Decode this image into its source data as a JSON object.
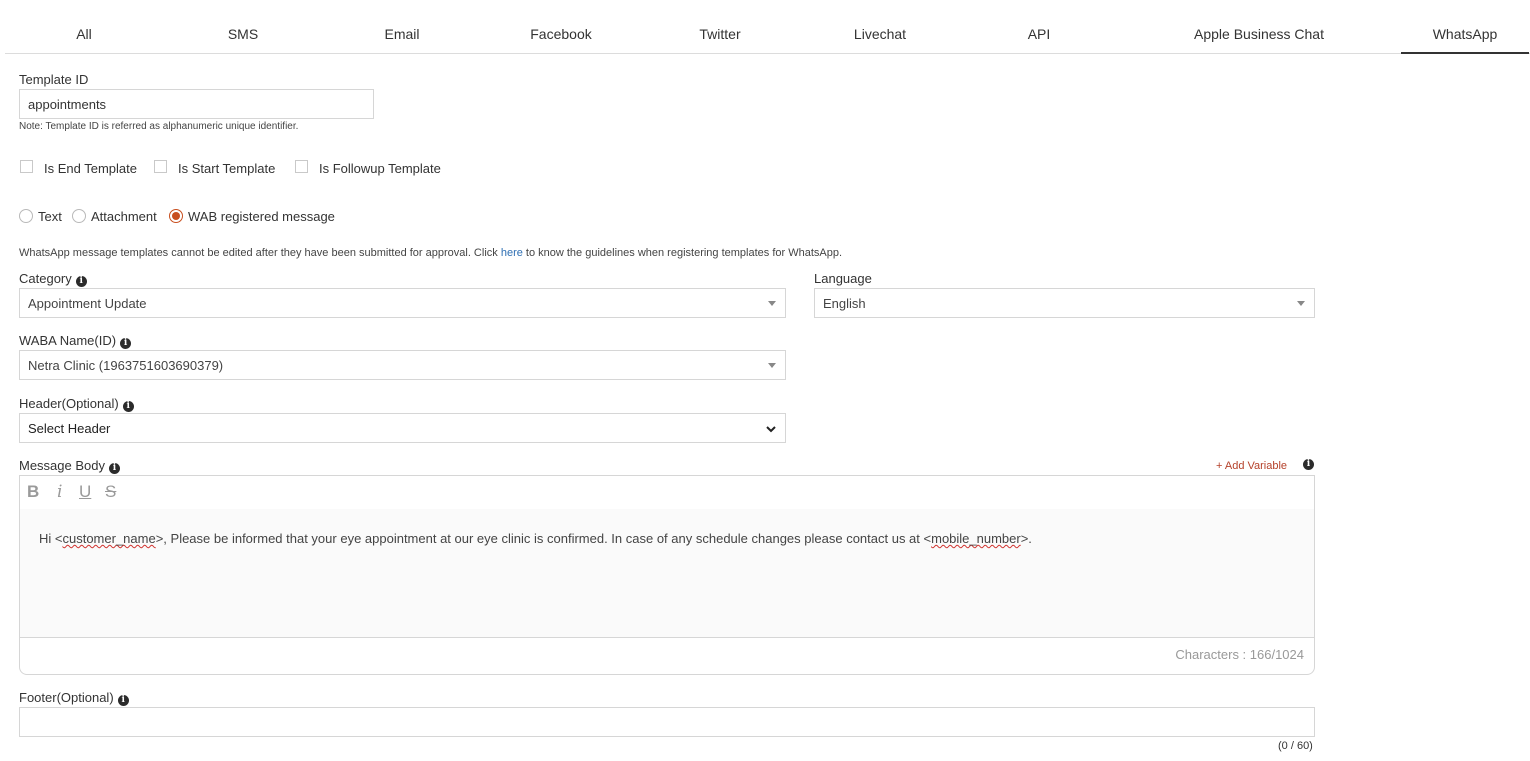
{
  "tabs": [
    {
      "label": "All"
    },
    {
      "label": "SMS"
    },
    {
      "label": "Email"
    },
    {
      "label": "Facebook"
    },
    {
      "label": "Twitter"
    },
    {
      "label": "Livechat"
    },
    {
      "label": "API"
    },
    {
      "label": "Apple Business Chat"
    },
    {
      "label": "WhatsApp"
    }
  ],
  "template_id": {
    "label": "Template ID",
    "value": "appointments",
    "note": "Note: Template ID is referred as alphanumeric unique identifier."
  },
  "checkboxes": [
    {
      "label": "Is End Template",
      "checked": false
    },
    {
      "label": "Is Start Template",
      "checked": false
    },
    {
      "label": "Is Followup Template",
      "checked": false
    }
  ],
  "message_types": [
    {
      "label": "Text",
      "selected": false
    },
    {
      "label": "Attachment",
      "selected": false
    },
    {
      "label": "WAB registered message",
      "selected": true
    }
  ],
  "guideline": {
    "before": "WhatsApp message templates cannot be edited after they have been submitted for approval. Click ",
    "link": "here",
    "after": " to know the guidelines when registering templates for WhatsApp."
  },
  "category": {
    "label": "Category",
    "value": "Appointment Update"
  },
  "language": {
    "label": "Language",
    "value": "English"
  },
  "waba": {
    "label": "WABA Name(ID)",
    "value": "Netra Clinic (1963751603690379)"
  },
  "header": {
    "label": "Header(Optional)",
    "value": "Select Header"
  },
  "message_body": {
    "label": "Message Body",
    "add_variable": "+ Add Variable",
    "toolbar": {
      "bold": "B",
      "italic": "i",
      "underline": "U",
      "strike": "S"
    },
    "text": {
      "p1": "Hi <",
      "var1": "customer_name",
      "p2": ">, Please be informed that your eye appointment at our eye clinic is confirmed. In case of any schedule changes please contact us at <",
      "var2": "mobile_number",
      "p3": ">."
    },
    "counter": "Characters : 166/1024"
  },
  "footer": {
    "label": "Footer(Optional)",
    "value": "",
    "counter": "(0 / 60)"
  },
  "colors": {
    "accent": "#c84f1f",
    "link": "#2f6fb3",
    "add_variable": "#b5412a"
  }
}
